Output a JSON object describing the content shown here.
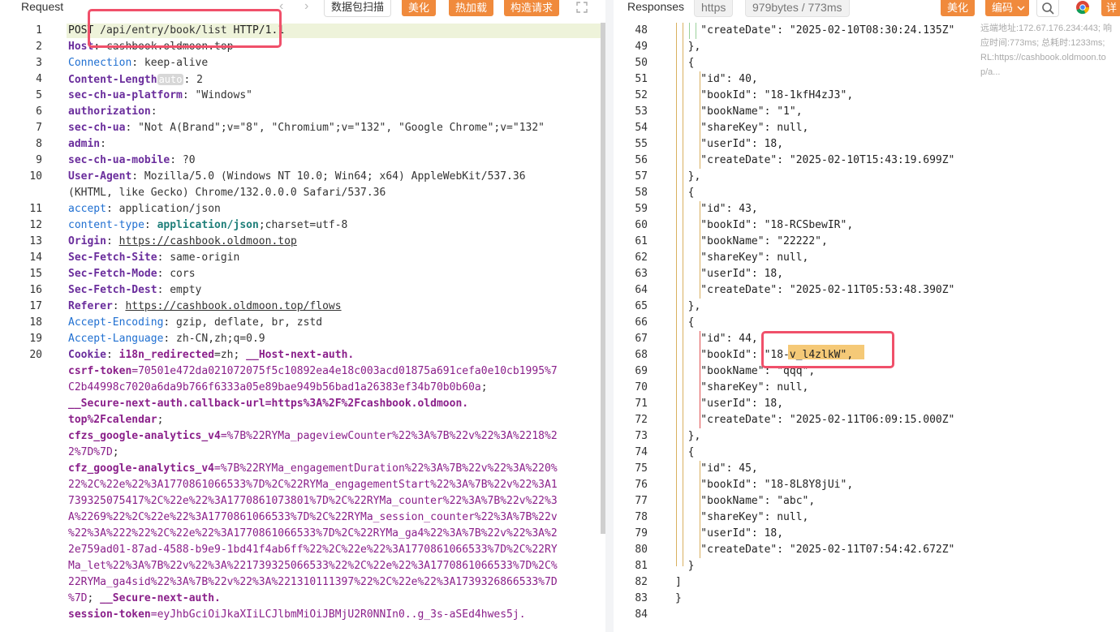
{
  "request": {
    "title": "Request",
    "nav_prev": "‹",
    "nav_next": "›",
    "buttons": {
      "scan": "数据包扫描",
      "beautify": "美化",
      "hot_load": "热加载",
      "construct": "构造请求"
    },
    "lines": [
      {
        "n": "1",
        "parts": [
          {
            "t": "POST",
            "c": "k-str"
          },
          {
            "t": " /api/entry/book/list ",
            "c": "k-val"
          },
          {
            "t": "HTTP/1.1",
            "c": "k-str"
          }
        ]
      },
      {
        "n": "2",
        "parts": [
          {
            "t": "Host",
            "c": "k-purple"
          },
          {
            "t": ": ",
            "c": "k-val"
          },
          {
            "t": "cashbook.oldmoon.top",
            "c": "k-val"
          }
        ]
      },
      {
        "n": "3",
        "parts": [
          {
            "t": "Connection",
            "c": "k-blue"
          },
          {
            "t": ": keep-alive",
            "c": "k-val"
          }
        ]
      },
      {
        "n": "4",
        "parts": [
          {
            "t": "Content-Length",
            "c": "k-purple"
          },
          {
            "t": "auto",
            "c": "autobadge"
          },
          {
            "t": ": 2",
            "c": "k-val"
          }
        ]
      },
      {
        "n": "5",
        "parts": [
          {
            "t": "sec-ch-ua-platform",
            "c": "k-purple"
          },
          {
            "t": ": \"Windows\"",
            "c": "k-val"
          }
        ]
      },
      {
        "n": "6",
        "parts": [
          {
            "t": "authorization",
            "c": "k-purple"
          },
          {
            "t": ": ",
            "c": "k-val"
          }
        ]
      },
      {
        "n": "7",
        "parts": [
          {
            "t": "sec-ch-ua",
            "c": "k-purple"
          },
          {
            "t": ": \"Not A(Brand\";v=\"8\", \"Chromium\";v=\"132\", \"Google Chrome\";v=\"132\"",
            "c": "k-val"
          }
        ]
      },
      {
        "n": "8",
        "parts": [
          {
            "t": "admin",
            "c": "k-purple"
          },
          {
            "t": ": ",
            "c": "k-val"
          }
        ]
      },
      {
        "n": "9",
        "parts": [
          {
            "t": "sec-ch-ua-mobile",
            "c": "k-purple"
          },
          {
            "t": ": ?0",
            "c": "k-val"
          }
        ]
      },
      {
        "n": "10",
        "parts": [
          {
            "t": "User-Agent",
            "c": "k-purple"
          },
          {
            "t": ": Mozilla/5.0 (Windows NT 10.0; Win64; x64) AppleWebKit/537.36",
            "c": "k-val"
          }
        ]
      },
      {
        "n": "",
        "parts": [
          {
            "t": "(KHTML, like Gecko) Chrome/132.0.0.0 Safari/537.36",
            "c": "k-val"
          }
        ]
      },
      {
        "n": "11",
        "parts": [
          {
            "t": "accept",
            "c": "k-blue"
          },
          {
            "t": ": application/json",
            "c": "k-val"
          }
        ]
      },
      {
        "n": "12",
        "parts": [
          {
            "t": "content-type",
            "c": "k-blue"
          },
          {
            "t": ": ",
            "c": "k-val"
          },
          {
            "t": "application/json",
            "c": "k-teal"
          },
          {
            "t": ";charset=utf-8",
            "c": "k-val"
          }
        ]
      },
      {
        "n": "13",
        "parts": [
          {
            "t": "Origin",
            "c": "k-purple"
          },
          {
            "t": ": ",
            "c": "k-val"
          },
          {
            "t": "https://cashbook.oldmoon.top",
            "c": "k-val underline"
          }
        ]
      },
      {
        "n": "14",
        "parts": [
          {
            "t": "Sec-Fetch-Site",
            "c": "k-purple"
          },
          {
            "t": ": same-origin",
            "c": "k-val"
          }
        ]
      },
      {
        "n": "15",
        "parts": [
          {
            "t": "Sec-Fetch-Mode",
            "c": "k-purple"
          },
          {
            "t": ": cors",
            "c": "k-val"
          }
        ]
      },
      {
        "n": "16",
        "parts": [
          {
            "t": "Sec-Fetch-Dest",
            "c": "k-purple"
          },
          {
            "t": ": empty",
            "c": "k-val"
          }
        ]
      },
      {
        "n": "17",
        "parts": [
          {
            "t": "Referer",
            "c": "k-purple"
          },
          {
            "t": ": ",
            "c": "k-val"
          },
          {
            "t": "https://cashbook.oldmoon.top/flows",
            "c": "k-val underline"
          }
        ]
      },
      {
        "n": "18",
        "parts": [
          {
            "t": "Accept-Encoding",
            "c": "k-blue"
          },
          {
            "t": ": gzip, deflate, br, zstd",
            "c": "k-val"
          }
        ]
      },
      {
        "n": "19",
        "parts": [
          {
            "t": "Accept-Language",
            "c": "k-blue"
          },
          {
            "t": ": zh-CN,zh;q=0.9",
            "c": "k-val"
          }
        ]
      },
      {
        "n": "20",
        "parts": [
          {
            "t": "Cookie",
            "c": "k-purple"
          },
          {
            "t": ": ",
            "c": "k-val"
          },
          {
            "t": "i18n_redirected",
            "c": "k-cookie-key"
          },
          {
            "t": "=zh; ",
            "c": "k-val"
          },
          {
            "t": "__Host-next-auth.",
            "c": "k-cookie-key"
          }
        ]
      },
      {
        "n": "",
        "parts": [
          {
            "t": "csrf-token",
            "c": "k-cookie-key"
          },
          {
            "t": "=70501e472da021072075f5c10892ea4e18c003acd01875a691cefa0e10cb1995%7",
            "c": "k-cookie-val"
          }
        ]
      },
      {
        "n": "",
        "parts": [
          {
            "t": "C2b44998c7020a6da9b766f6333a05e89bae949b56bad1a26383ef34b70b0b60a",
            "c": "k-cookie-val"
          },
          {
            "t": "; ",
            "c": "k-val"
          }
        ]
      },
      {
        "n": "",
        "parts": [
          {
            "t": "__Secure-next-auth.callback-url",
            "c": "k-cookie-key"
          },
          {
            "t": "=https%3A%2F%2Fcashbook.oldmoon.",
            "c": "k-cookie-key"
          }
        ]
      },
      {
        "n": "",
        "parts": [
          {
            "t": "top%2Fcalendar",
            "c": "k-cookie-key"
          },
          {
            "t": "; ",
            "c": "k-val"
          }
        ]
      },
      {
        "n": "",
        "parts": [
          {
            "t": "cfzs_google-analytics_v4",
            "c": "k-cookie-key"
          },
          {
            "t": "=%7B%22RYMa_pageviewCounter%22%3A%7B%22v%22%3A%2218%2",
            "c": "k-cookie-val"
          }
        ]
      },
      {
        "n": "",
        "parts": [
          {
            "t": "2%7D%7D",
            "c": "k-cookie-val"
          },
          {
            "t": "; ",
            "c": "k-val"
          }
        ]
      },
      {
        "n": "",
        "parts": [
          {
            "t": "cfz_google-analytics_v4",
            "c": "k-cookie-key"
          },
          {
            "t": "=%7B%22RYMa_engagementDuration%22%3A%7B%22v%22%3A%220%",
            "c": "k-cookie-val"
          }
        ]
      },
      {
        "n": "",
        "parts": [
          {
            "t": "22%2C%22e%22%3A1770861066533%7D%2C%22RYMa_engagementStart%22%3A%7B%22v%22%3A1",
            "c": "k-cookie-val"
          }
        ]
      },
      {
        "n": "",
        "parts": [
          {
            "t": "739325075417%2C%22e%22%3A1770861073801%7D%2C%22RYMa_counter%22%3A%7B%22v%22%3",
            "c": "k-cookie-val"
          }
        ]
      },
      {
        "n": "",
        "parts": [
          {
            "t": "A%2269%22%2C%22e%22%3A1770861066533%7D%2C%22RYMa_session_counter%22%3A%7B%22v",
            "c": "k-cookie-val"
          }
        ]
      },
      {
        "n": "",
        "parts": [
          {
            "t": "%22%3A%222%22%2C%22e%22%3A1770861066533%7D%2C%22RYMa_ga4%22%3A%7B%22v%22%3A%2",
            "c": "k-cookie-val"
          }
        ]
      },
      {
        "n": "",
        "parts": [
          {
            "t": "2e759ad01-87ad-4588-b9e9-1bd41f4ab6ff%22%2C%22e%22%3A1770861066533%7D%2C%22RY",
            "c": "k-cookie-val"
          }
        ]
      },
      {
        "n": "",
        "parts": [
          {
            "t": "Ma_let%22%3A%7B%22v%22%3A%221739325066533%22%2C%22e%22%3A1770861066533%7D%2C%",
            "c": "k-cookie-val"
          }
        ]
      },
      {
        "n": "",
        "parts": [
          {
            "t": "22RYMa_ga4sid%22%3A%7B%22v%22%3A%221310111397%22%2C%22e%22%3A1739326866533%7D",
            "c": "k-cookie-val"
          }
        ]
      },
      {
        "n": "",
        "parts": [
          {
            "t": "%7D",
            "c": "k-cookie-val"
          },
          {
            "t": "; ",
            "c": "k-val"
          },
          {
            "t": "__Secure-next-auth.",
            "c": "k-cookie-key"
          }
        ]
      },
      {
        "n": "",
        "parts": [
          {
            "t": "session-token",
            "c": "k-cookie-key"
          },
          {
            "t": "=eyJhbGciOiJkaXIiLCJlbmMiOiJBMjU2R0NNIn0..g_3s-aSEd4hwes5j.",
            "c": "k-cookie-val"
          }
        ]
      }
    ]
  },
  "response": {
    "title": "Responses",
    "protocol": "https",
    "size_time": "979bytes / 773ms",
    "buttons": {
      "beautify": "美化",
      "encoding": "编码",
      "detail": "详"
    },
    "tooltip": [
      "远端地址:172.67.176.234:443; 响",
      "应时间:773ms; 总耗时:1233ms;",
      "RL:https://cashbook.oldmoon.to",
      "p/a..."
    ],
    "lines": [
      {
        "n": "48",
        "t": "    \"createDate\": \"2025-02-10T08:30:24.135Z\""
      },
      {
        "n": "49",
        "t": "  },"
      },
      {
        "n": "50",
        "t": "  {"
      },
      {
        "n": "51",
        "t": "    \"id\": 40,"
      },
      {
        "n": "52",
        "t": "    \"bookId\": \"18-1kfH4zJ3\","
      },
      {
        "n": "53",
        "t": "    \"bookName\": \"1\","
      },
      {
        "n": "54",
        "t": "    \"shareKey\": null,"
      },
      {
        "n": "55",
        "t": "    \"userId\": 18,"
      },
      {
        "n": "56",
        "t": "    \"createDate\": \"2025-02-10T15:43:19.699Z\""
      },
      {
        "n": "57",
        "t": "  },"
      },
      {
        "n": "58",
        "t": "  {"
      },
      {
        "n": "59",
        "t": "    \"id\": 43,"
      },
      {
        "n": "60",
        "t": "    \"bookId\": \"18-RCSbewIR\","
      },
      {
        "n": "61",
        "t": "    \"bookName\": \"22222\","
      },
      {
        "n": "62",
        "t": "    \"shareKey\": null,"
      },
      {
        "n": "63",
        "t": "    \"userId\": 18,"
      },
      {
        "n": "64",
        "t": "    \"createDate\": \"2025-02-11T05:53:48.390Z\""
      },
      {
        "n": "65",
        "t": "  },"
      },
      {
        "n": "66",
        "t": "  {"
      },
      {
        "n": "67",
        "t": "    \"id\": 44,"
      },
      {
        "n": "68",
        "t": "    \"bookId\": \"18-v_l4zlkW\","
      },
      {
        "n": "69",
        "t": "    \"bookName\": \"qqq\","
      },
      {
        "n": "70",
        "t": "    \"shareKey\": null,"
      },
      {
        "n": "71",
        "t": "    \"userId\": 18,"
      },
      {
        "n": "72",
        "t": "    \"createDate\": \"2025-02-11T06:09:15.000Z\""
      },
      {
        "n": "73",
        "t": "  },"
      },
      {
        "n": "74",
        "t": "  {"
      },
      {
        "n": "75",
        "t": "    \"id\": 45,"
      },
      {
        "n": "76",
        "t": "    \"bookId\": \"18-8L8Y8jUi\","
      },
      {
        "n": "77",
        "t": "    \"bookName\": \"abc\","
      },
      {
        "n": "78",
        "t": "    \"shareKey\": null,"
      },
      {
        "n": "79",
        "t": "    \"userId\": 18,"
      },
      {
        "n": "80",
        "t": "    \"createDate\": \"2025-02-11T07:54:42.672Z\""
      },
      {
        "n": "81",
        "t": "  }"
      },
      {
        "n": "82",
        "t": "]"
      },
      {
        "n": "83",
        "t": "}"
      },
      {
        "n": "84",
        "t": ""
      }
    ]
  },
  "colors": {
    "accent_orange": "#f08a3c",
    "highlight_red": "#f0506a",
    "selection": "#f5c977"
  },
  "icons": {
    "expand": "expand-icon",
    "search": "search-icon",
    "chrome": "chrome-icon",
    "chevron": "chevron-down-icon"
  }
}
